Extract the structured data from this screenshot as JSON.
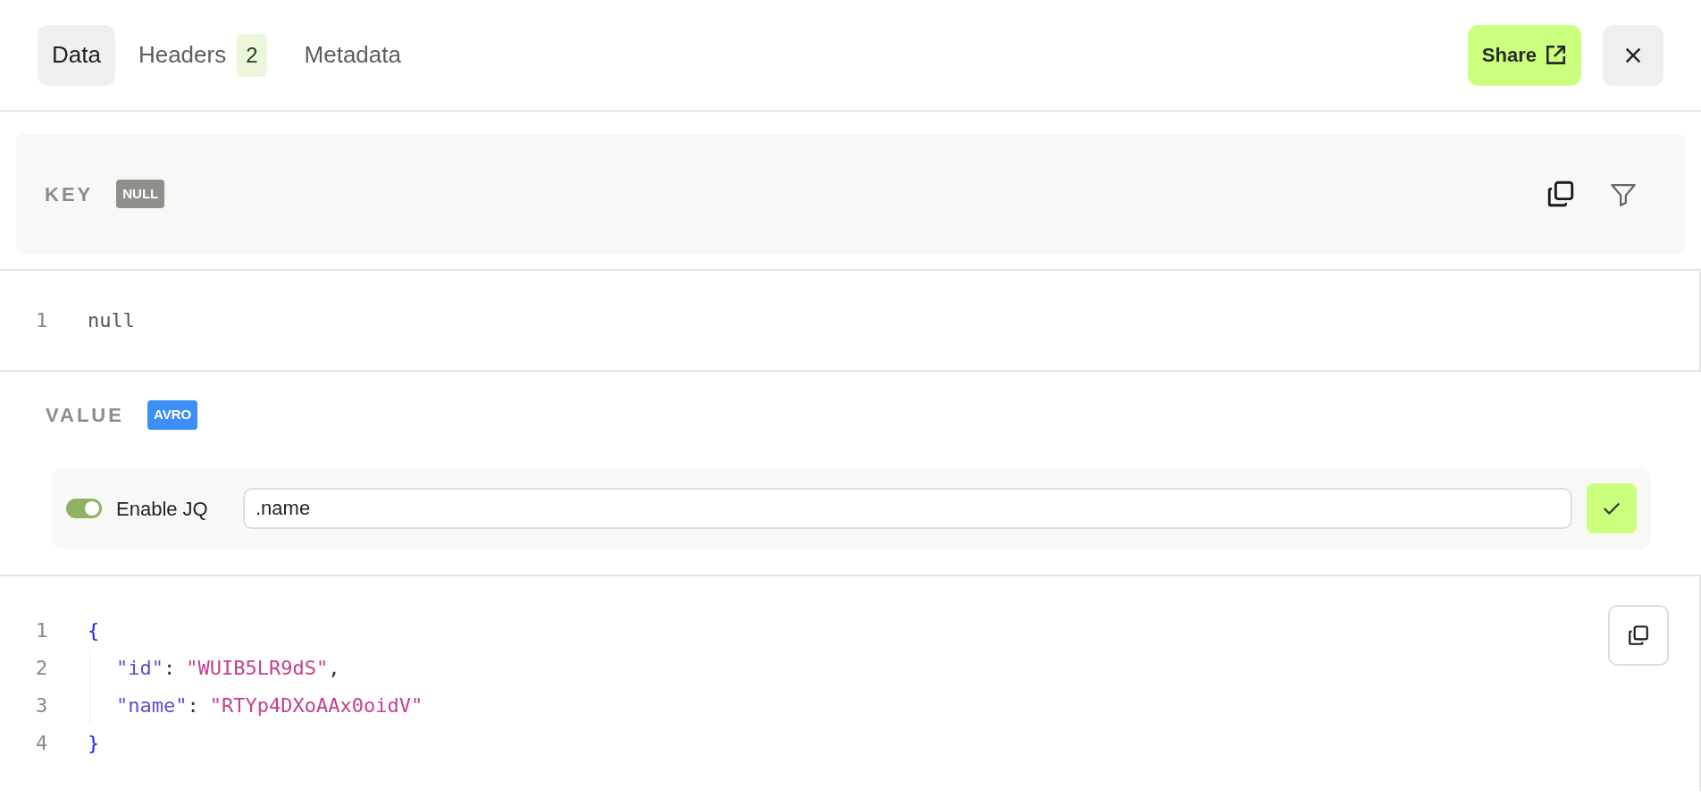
{
  "tabs": [
    {
      "label": "Data",
      "selected": true
    },
    {
      "label": "Headers",
      "selected": false,
      "count": "2"
    },
    {
      "label": "Metadata",
      "selected": false
    }
  ],
  "share_button": {
    "label": "Share"
  },
  "key_section": {
    "label": "KEY",
    "badge": {
      "text": "NULL",
      "color": "#8f8f8c"
    },
    "code": [
      {
        "number": "1",
        "tokens": [
          {
            "kind": "plain",
            "text": "null"
          }
        ]
      }
    ]
  },
  "value_section": {
    "label": "VALUE",
    "badge": {
      "text": "AVRO",
      "color": "#3d8ef7"
    },
    "jq": {
      "label": "Enable JQ",
      "on": true,
      "value": ".name"
    },
    "code": [
      {
        "number": "1",
        "tokens": [
          {
            "kind": "brace",
            "text": "{"
          }
        ]
      },
      {
        "number": "2",
        "tokens": [
          {
            "kind": "key",
            "text": "\"id\""
          },
          {
            "kind": "punct",
            "text": ":"
          },
          {
            "kind": "string",
            "text": "\"WUIB5LR9dS\""
          },
          {
            "kind": "punct",
            "text": ","
          }
        ]
      },
      {
        "number": "3",
        "tokens": [
          {
            "kind": "key",
            "text": "\"name\""
          },
          {
            "kind": "punct",
            "text": ":"
          },
          {
            "kind": "string",
            "text": "\"RTYp4DXoAAx0oidV\""
          }
        ]
      },
      {
        "number": "4",
        "tokens": [
          {
            "kind": "brace",
            "text": "}"
          }
        ]
      }
    ]
  }
}
